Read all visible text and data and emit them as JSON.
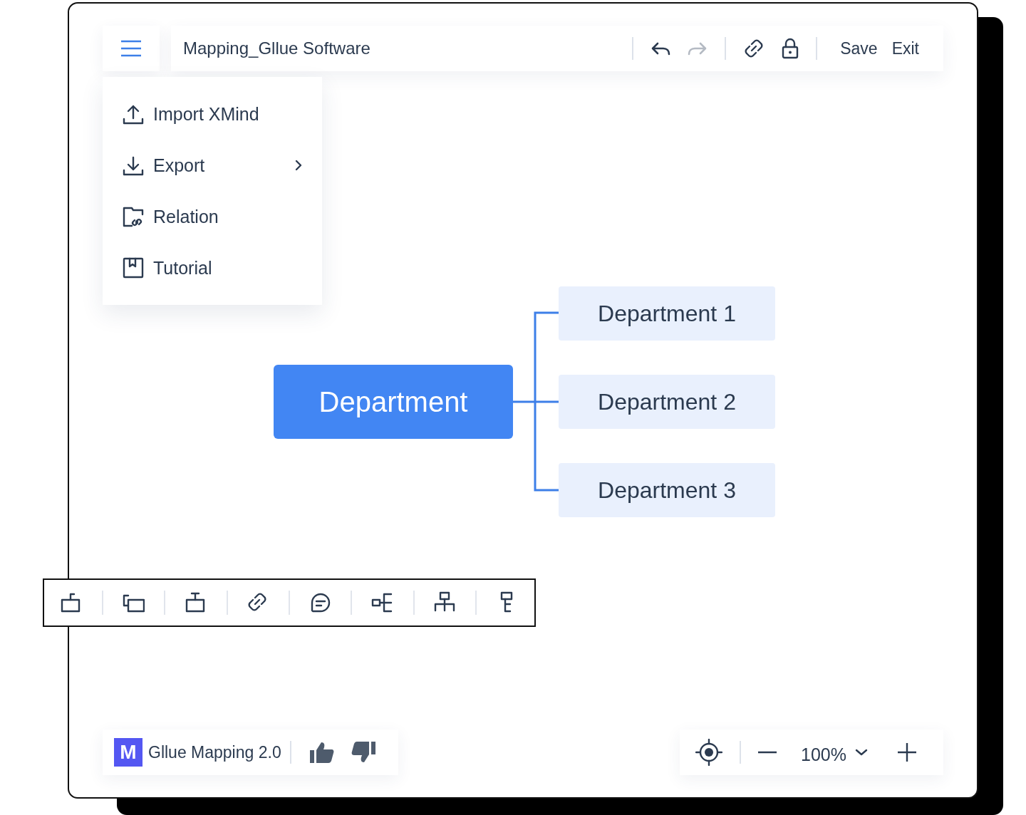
{
  "header": {
    "title": "Mapping_Gllue Software",
    "history": [
      {
        "kind": "undo",
        "disabled": false
      },
      {
        "kind": "redo",
        "disabled": true
      }
    ],
    "buttons": [
      "Save",
      "Exit"
    ]
  },
  "menu": {
    "items": [
      {
        "label": "Import XMind",
        "submenu": false
      },
      {
        "label": "Export",
        "submenu": true
      },
      {
        "label": "Relation",
        "submenu": false
      },
      {
        "label": "Tutorial",
        "submenu": false
      }
    ]
  },
  "mindmap": {
    "root": "Department",
    "children": [
      "Department 1",
      "Department 2",
      "Department 3"
    ]
  },
  "footer": {
    "logo": "M",
    "product": "Gllue Mapping 2.0",
    "zoom": "100%"
  }
}
